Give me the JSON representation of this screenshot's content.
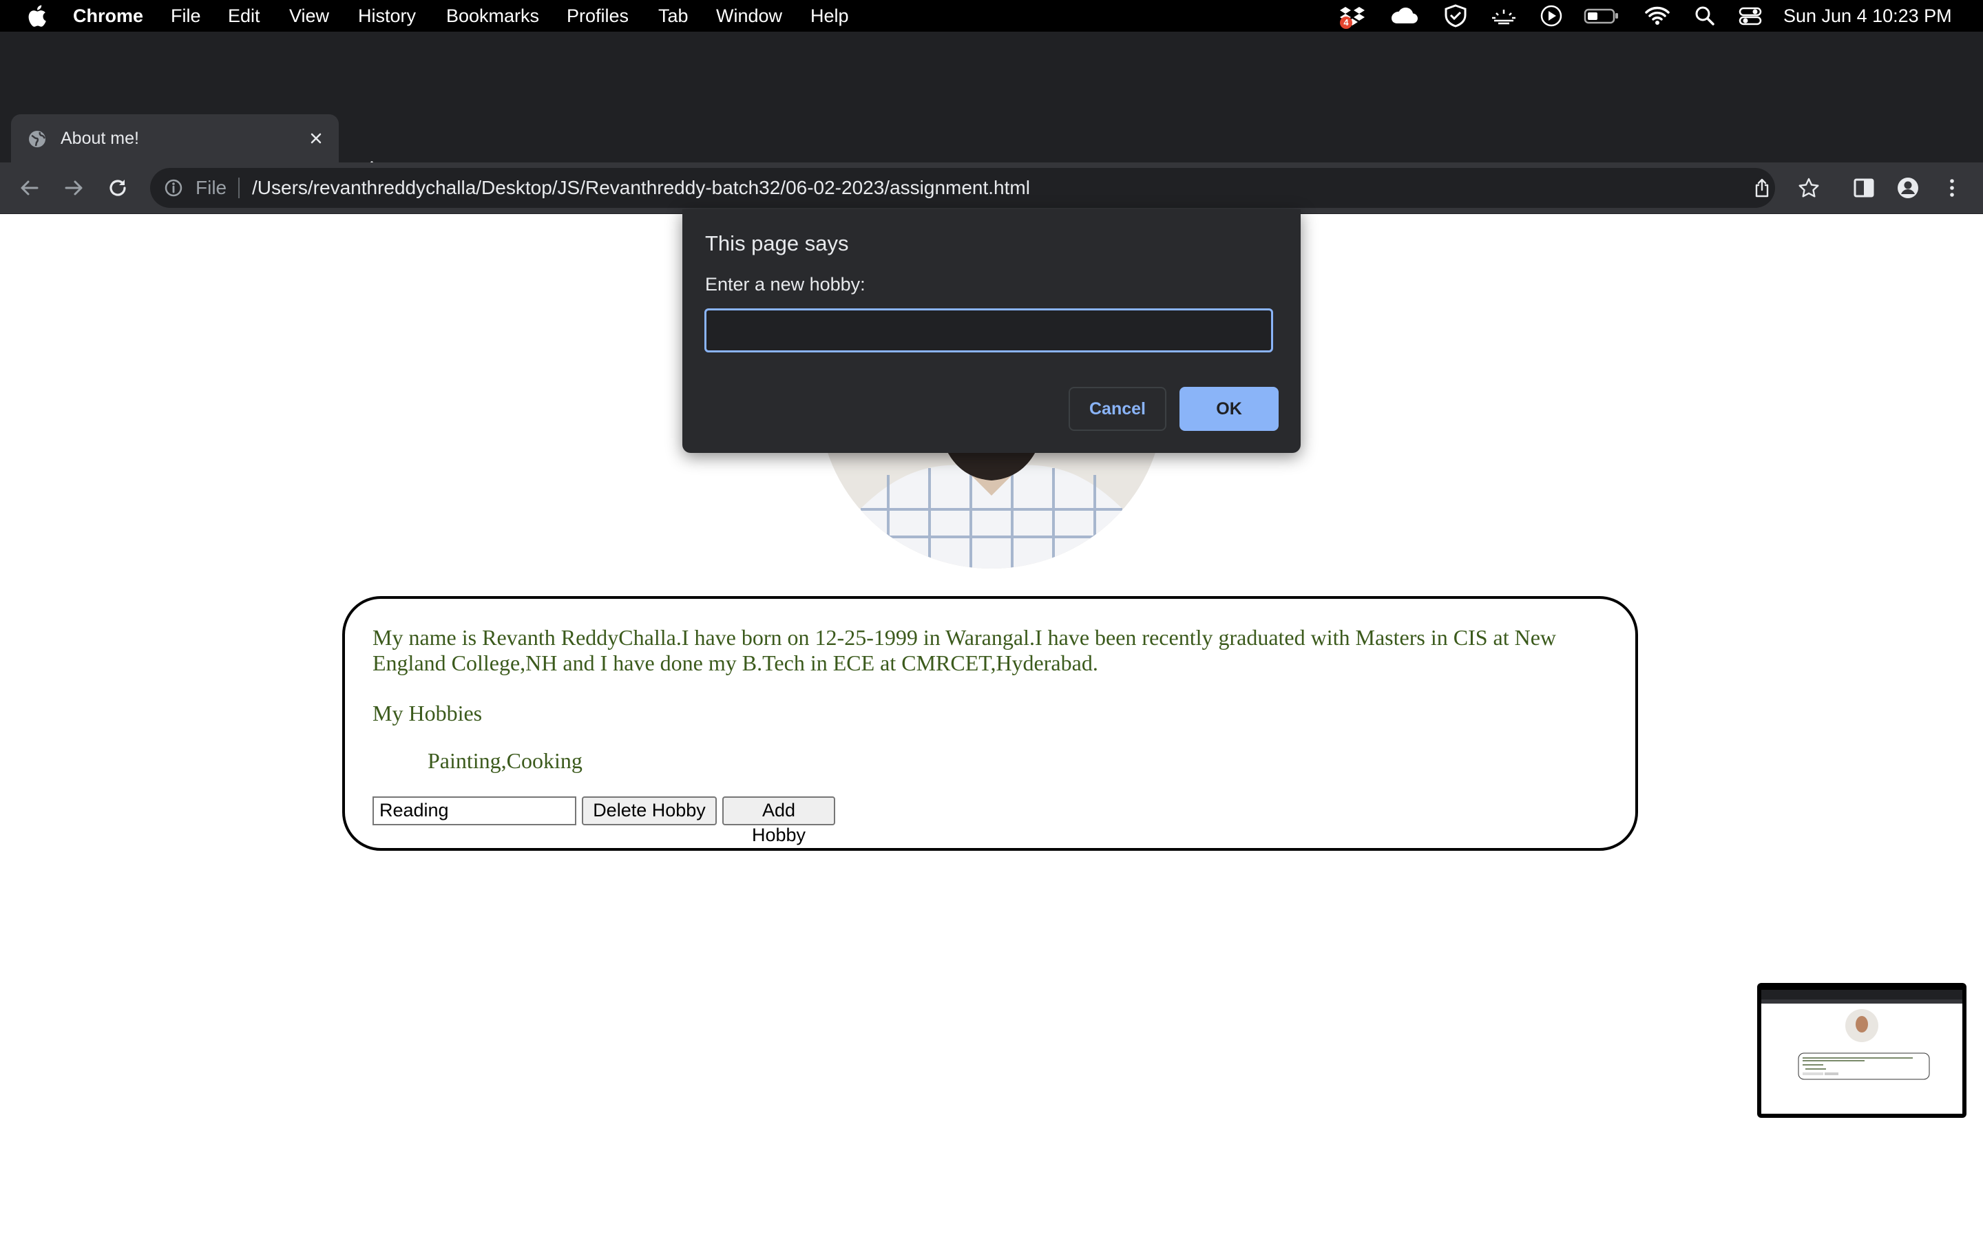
{
  "menubar": {
    "app": "Chrome",
    "items": [
      "File",
      "Edit",
      "View",
      "History",
      "Bookmarks",
      "Profiles",
      "Tab",
      "Window",
      "Help"
    ],
    "dropbox_badge": "4",
    "datetime": "Sun Jun 4  10:23 PM"
  },
  "browser": {
    "tab_title": "About me!",
    "scheme_label": "File",
    "url": "/Users/revanthreddychalla/Desktop/JS/Revanthreddy-batch32/06-02-2023/assignment.html"
  },
  "page": {
    "bio": "My name is Revanth ReddyChalla.I have born on 12-25-1999 in Warangal.I have been recently graduated with Masters in CIS at New England College,NH and I have done my B.Tech in ECE at CMRCET,Hyderabad.",
    "hobbies_heading": "My Hobbies",
    "hobbies_list": "Painting,Cooking",
    "hobby_input_value": "Reading",
    "delete_button": "Delete Hobby",
    "add_button": "Add Hobby",
    "text_color": "#3b5a1c"
  },
  "dialog": {
    "title": "This page says",
    "message": "Enter a new hobby:",
    "input_value": "",
    "cancel_label": "Cancel",
    "ok_label": "OK",
    "accent": "#8ab4f8"
  },
  "icons": {
    "menubar": [
      "apple-icon",
      "dropbox-icon",
      "icloud-icon",
      "shield-icon",
      "night-shift-icon",
      "play-icon",
      "battery-icon",
      "wifi-icon",
      "spotlight-icon",
      "control-center-icon"
    ],
    "toolbar": [
      "back-icon",
      "forward-icon",
      "reload-icon",
      "info-icon",
      "share-icon",
      "star-icon",
      "side-panel-icon",
      "profile-icon",
      "kebab-menu-icon"
    ]
  }
}
